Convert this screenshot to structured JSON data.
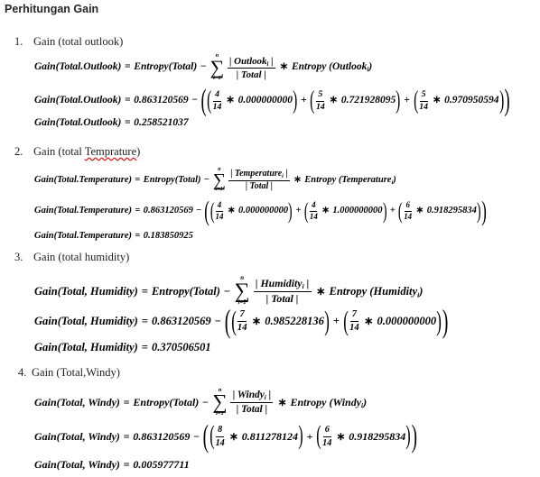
{
  "title": "Perhitungan Gain",
  "symbols": {
    "eq": "=",
    "minus": "−",
    "times": "∗",
    "plus": "+",
    "lparen": "(",
    "rparen": ")",
    "sum": "∑"
  },
  "sections": [
    {
      "number": "1.",
      "heading": "Gain (total outlook)",
      "definition": {
        "lhs": "Gain(Total.Outlook)",
        "entropy_total": "Entropy(Total)",
        "sum_upper": "n",
        "sum_lower": "i=1",
        "ratio_num": "| Outlook",
        "ratio_num_sub": "i",
        "ratio_num_close": " |",
        "ratio_den": "| Total |",
        "entropy_attr": "Entropy (Outlook",
        "entropy_attr_sub": "i",
        "entropy_attr_close": ")"
      },
      "computation": {
        "lhs": "Gain(Total.Outlook)",
        "entropy_total": "0.863120569",
        "terms": [
          {
            "num": "4",
            "den": "14",
            "entropy": "0.000000000"
          },
          {
            "num": "5",
            "den": "14",
            "entropy": "0.721928095"
          },
          {
            "num": "5",
            "den": "14",
            "entropy": "0.970950594"
          }
        ]
      },
      "result": {
        "lhs": "Gain(Total.Outlook)",
        "value": "0.258521037"
      }
    },
    {
      "number": "2.",
      "heading": "Gain (total ",
      "heading_flagged": "Temprature",
      "heading_end": ")",
      "definition": {
        "lhs": "Gain(Total.Temperature)",
        "entropy_total": "Entropy(Total)",
        "sum_upper": "n",
        "sum_lower": "i=1",
        "ratio_num": "| Temperature",
        "ratio_num_sub": "i",
        "ratio_num_close": " |",
        "ratio_den": "| Total |",
        "entropy_attr": "Entropy (Temperature",
        "entropy_attr_sub": "i",
        "entropy_attr_close": ")"
      },
      "computation": {
        "lhs": "Gain(Total.Temperature)",
        "entropy_total": "0.863120569",
        "terms": [
          {
            "num": "4",
            "den": "14",
            "entropy": "0.000000000"
          },
          {
            "num": "4",
            "den": "14",
            "entropy": "1.000000000"
          },
          {
            "num": "6",
            "den": "14",
            "entropy": "0.918295834"
          }
        ]
      },
      "result": {
        "lhs": "Gain(Total.Temperature)",
        "value": "0.183850925"
      }
    },
    {
      "number": "3.",
      "heading": "Gain (total humidity)",
      "definition": {
        "lhs": "Gain(Total, Humidity)",
        "entropy_total": "Entropy(Total)",
        "sum_upper": "n",
        "sum_lower": "i=1",
        "ratio_num": "| Humidity",
        "ratio_num_sub": "i",
        "ratio_num_close": " |",
        "ratio_den": "| Total |",
        "entropy_attr": "Entropy (Humidity",
        "entropy_attr_sub": "i",
        "entropy_attr_close": ")"
      },
      "computation": {
        "lhs": "Gain(Total, Humidity)",
        "entropy_total": "0.863120569",
        "terms": [
          {
            "num": "7",
            "den": "14",
            "entropy": "0.985228136"
          },
          {
            "num": "7",
            "den": "14",
            "entropy": "0.000000000"
          }
        ]
      },
      "result": {
        "lhs": "Gain(Total, Humidity)",
        "value": "0.370506501"
      }
    },
    {
      "number": "4.",
      "heading": "Gain (Total,Windy)",
      "definition": {
        "lhs": "Gain(Total, Windy)",
        "entropy_total": "Entropy(Total)",
        "sum_upper": "n",
        "sum_lower": "i=1",
        "ratio_num": "| Windy",
        "ratio_num_sub": "i",
        "ratio_num_close": " |",
        "ratio_den": "| Total |",
        "entropy_attr": "Entropy (Windy",
        "entropy_attr_sub": "i",
        "entropy_attr_close": ")"
      },
      "computation": {
        "lhs": "Gain(Total, Windy)",
        "entropy_total": "0.863120569",
        "terms": [
          {
            "num": "8",
            "den": "14",
            "entropy": "0.811278124"
          },
          {
            "num": "6",
            "den": "14",
            "entropy": "0.918295834"
          }
        ]
      },
      "result": {
        "lhs": "Gain(Total, Windy)",
        "value": "0.005977711"
      }
    }
  ]
}
